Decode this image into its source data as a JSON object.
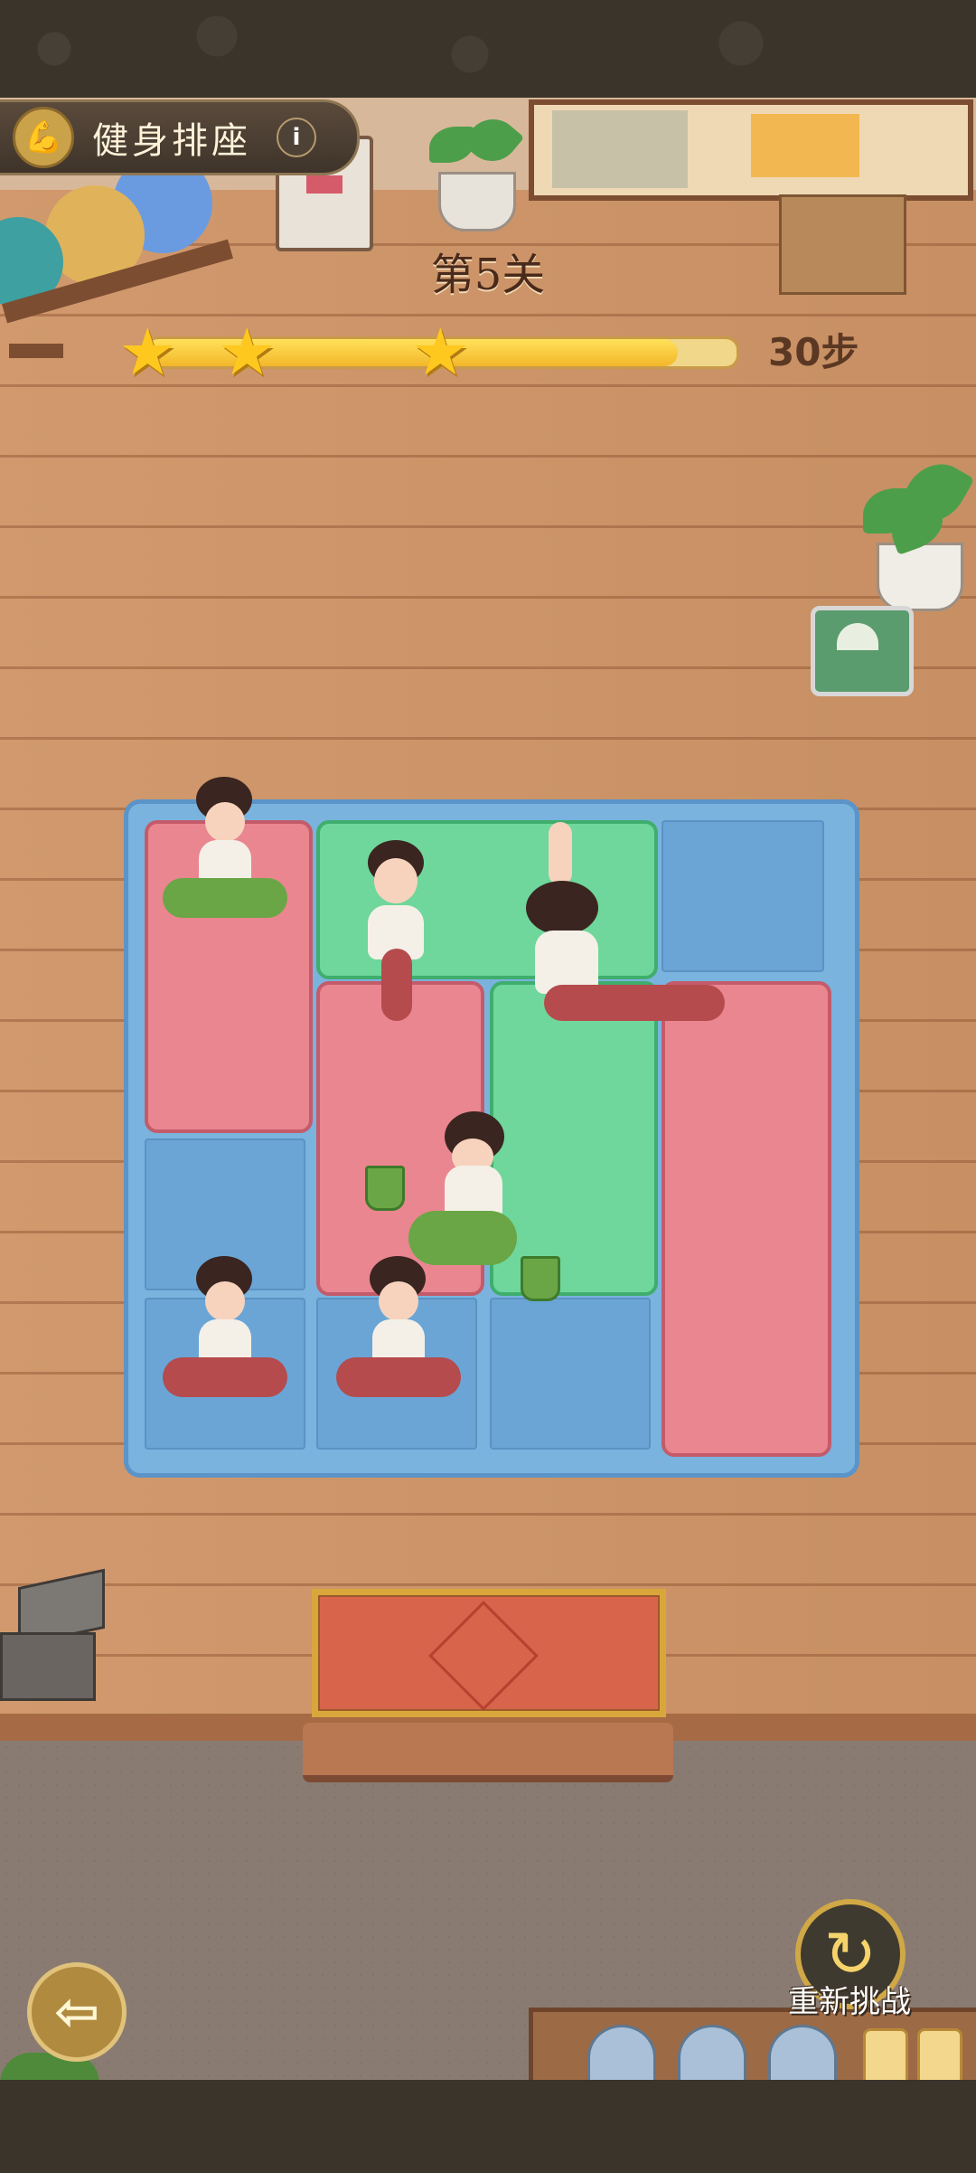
{
  "header": {
    "title": "健身排座",
    "info_label": "i",
    "title_icon": "flexed-arm-icon"
  },
  "level": {
    "label": "第5关",
    "steps_label": "30步",
    "progress": 0.9,
    "stars_earned": 3
  },
  "board": {
    "rows": 4,
    "cols": 4
  },
  "footer": {
    "retry_label": "重新挑战",
    "back_icon": "back-arrow-icon",
    "retry_icon": "refresh-icon"
  },
  "colors": {
    "pink_mat": "#e9868f",
    "green_mat": "#6fd79b",
    "board_blue": "#7ab3de",
    "star_gold": "#ffc81f"
  }
}
